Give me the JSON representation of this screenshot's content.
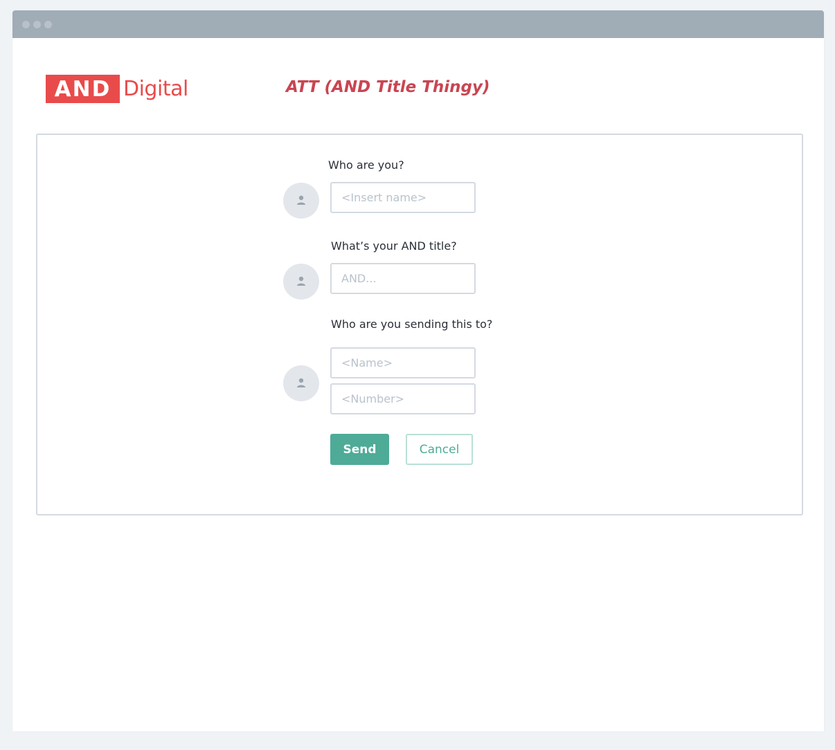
{
  "brand": {
    "logo_box": "AND",
    "logo_text": "Digital",
    "color": "#e94b4b"
  },
  "header": {
    "title": "ATT (AND Title Thingy)",
    "title_color": "#c94551"
  },
  "form": {
    "who_label": "Who are you?",
    "name_placeholder": "<Insert name>",
    "title_label": "What’s your AND title?",
    "title_placeholder": "AND...",
    "recipient_label": "Who are you sending this to?",
    "recipient_name_placeholder": "<Name>",
    "recipient_number_placeholder": "<Number>",
    "avatar_icon": "person-icon"
  },
  "actions": {
    "send_label": "Send",
    "cancel_label": "Cancel",
    "accent": "#4eab97"
  }
}
